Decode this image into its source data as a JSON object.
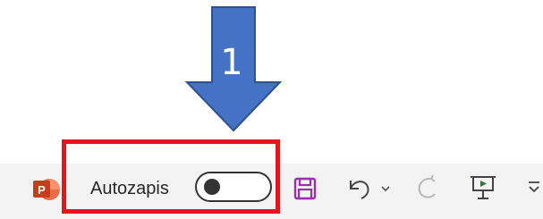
{
  "callout": {
    "number": "1",
    "arrow_color": "#4472c4",
    "arrow_outline": "#2f528f",
    "highlight_color": "#e8141b"
  },
  "toolbar": {
    "app_icon": {
      "name": "powerpoint-icon",
      "letter": "P",
      "color": "#c43e1c"
    },
    "autosave": {
      "label": "Autozapis",
      "toggle_state": "off"
    },
    "icons": [
      {
        "name": "save-icon",
        "color": "#9b2fae"
      },
      {
        "name": "undo-icon"
      },
      {
        "name": "undo-dropdown-chevron-icon"
      },
      {
        "name": "redo-icon"
      },
      {
        "name": "start-slideshow-icon",
        "accent": "#2e7d32"
      },
      {
        "name": "customize-toolbar-icon"
      }
    ]
  }
}
